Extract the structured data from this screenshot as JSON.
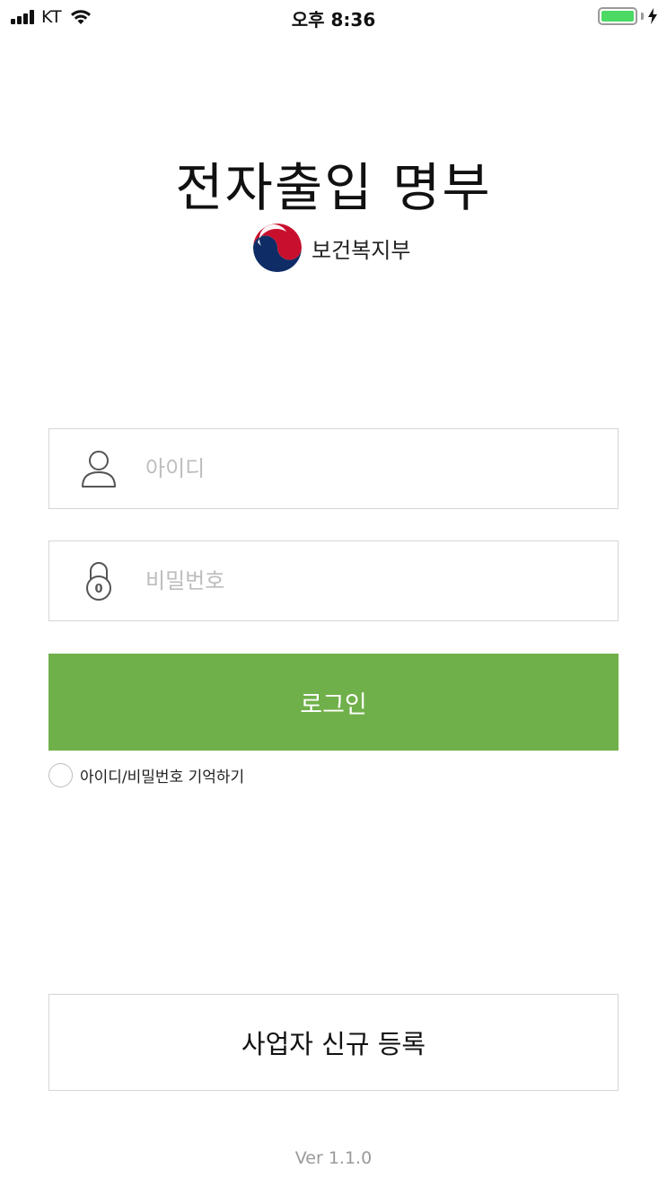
{
  "status_bar": {
    "carrier": "KT",
    "time": "오후 8:36",
    "battery_level": 1.0,
    "battery_color": "#4cd964",
    "icons": [
      "signal-icon",
      "wifi-icon",
      "battery-icon",
      "charging-bolt-icon"
    ]
  },
  "header": {
    "title": "전자출입 명부",
    "ministry_name": "보건복지부",
    "logo_icon": "taegeuk-emblem-icon"
  },
  "login_form": {
    "id_field": {
      "placeholder": "아이디",
      "value": "",
      "icon": "user-icon"
    },
    "password_field": {
      "placeholder": "비밀번호",
      "value": "",
      "icon": "lock-icon"
    },
    "login_button": "로그인",
    "remember_label": "아이디/비밀번호 기억하기",
    "remember_checked": false
  },
  "register_button": "사업자 신규 등록",
  "version": "Ver 1.1.0",
  "colors": {
    "primary_green": "#70b04a",
    "border_gray": "#d5d5d5",
    "placeholder_gray": "#bdbdbd"
  }
}
